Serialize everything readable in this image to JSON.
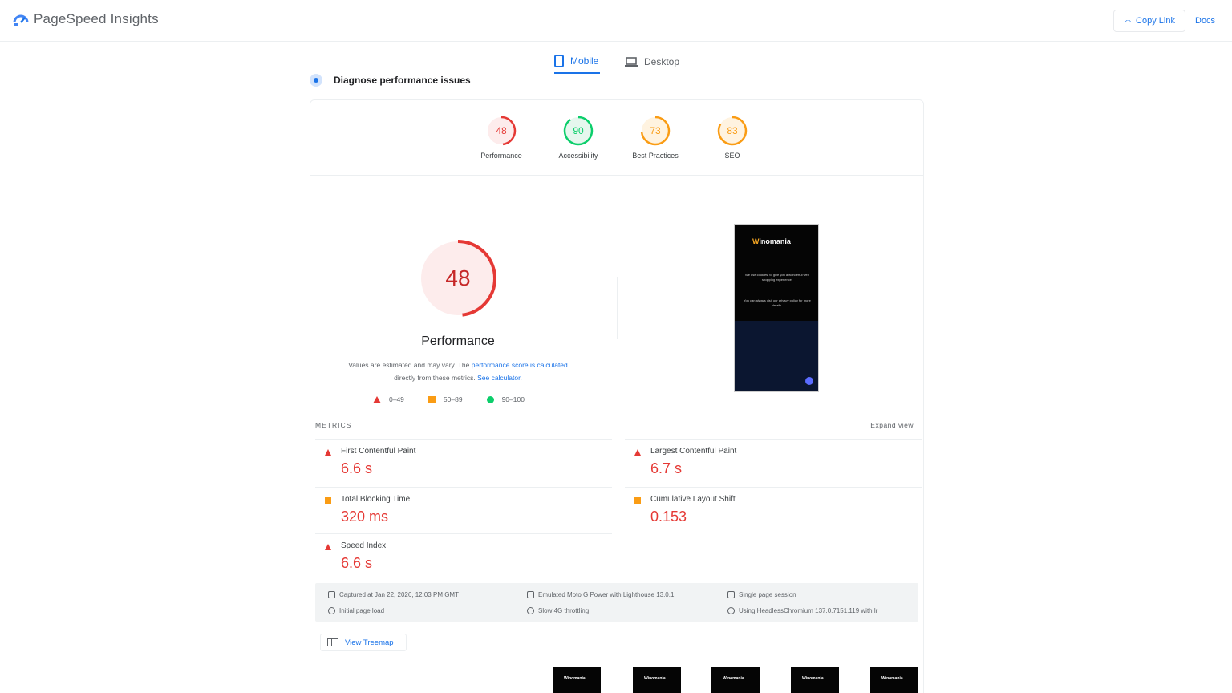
{
  "header": {
    "brand": "PageSpeed Insights",
    "copy_link": "Copy Link",
    "docs": "Docs"
  },
  "tabs": [
    {
      "label": "Mobile",
      "active": true,
      "icon": "phone-icon"
    },
    {
      "label": "Desktop",
      "active": false,
      "icon": "laptop-icon"
    }
  ],
  "diagnose_title": "Diagnose performance issues",
  "scores": [
    {
      "label": "Performance",
      "value": 48,
      "color": "#e53935",
      "bg": "#fdecec"
    },
    {
      "label": "Accessibility",
      "value": 90,
      "color": "#0cce6b",
      "bg": "#e6f7ee"
    },
    {
      "label": "Best Practices",
      "value": 73,
      "color": "#fa9c14",
      "bg": "#fff3e0"
    },
    {
      "label": "SEO",
      "value": 83,
      "color": "#fa9c14",
      "bg": "#fff3e0"
    }
  ],
  "performance": {
    "score": 48,
    "title": "Performance",
    "desc_prefix": "Values are estimated and may vary. The ",
    "desc_link1": "performance score is calculated",
    "desc_middle": " directly from these metrics. ",
    "desc_link2": "See calculator.",
    "legend": [
      "0–49",
      "50–89",
      "90–100"
    ]
  },
  "screenshot": {
    "logo_w": "W",
    "logo_rest": "inomania",
    "text1": "We use cookies, to give you a wonderful web shopping experience.",
    "text2": "You can always visit our privacy policy for more details."
  },
  "metrics": {
    "label": "METRICS",
    "expand": "Expand view",
    "items": [
      {
        "name": "First Contentful Paint",
        "value": "6.6 s",
        "status": "poor"
      },
      {
        "name": "Largest Contentful Paint",
        "value": "6.7 s",
        "status": "poor"
      },
      {
        "name": "Total Blocking Time",
        "value": "320 ms",
        "status": "average"
      },
      {
        "name": "Cumulative Layout Shift",
        "value": "0.153",
        "status": "average"
      },
      {
        "name": "Speed Index",
        "value": "6.6 s",
        "status": "poor"
      }
    ]
  },
  "info": {
    "captured": "Captured at Jan 22, 2026, 12:03 PM GMT",
    "load": "Initial page load",
    "device": "Emulated Moto G Power with Lighthouse 13.0.1",
    "throttle": "Slow 4G throttling",
    "session": "Single page session",
    "browser": "Using HeadlessChromium 137.0.7151.119 with lr"
  },
  "treemap_label": "View Treemap",
  "thumb_logo": "Winomania"
}
